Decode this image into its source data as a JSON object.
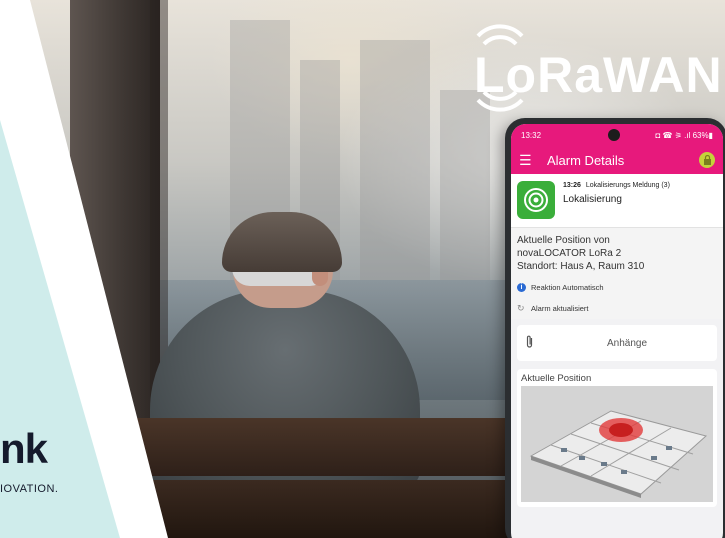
{
  "brand": {
    "word": "nk",
    "tagline": "IOVATION."
  },
  "lorawan": {
    "logo_text": "LoRaWAN",
    "icon": "wireless-signal-icon"
  },
  "phone": {
    "status_bar": {
      "time": "13:32",
      "indicators": "◘ ☎ ⚞ .ıl 63%▮"
    },
    "app_bar": {
      "title": "Alarm Details",
      "menu_icon": "hamburger-menu-icon",
      "lock_icon": "lock-icon",
      "accent_color": "#e7197c",
      "lock_color": "#c5d33a"
    },
    "alarm": {
      "time": "13:26",
      "type": "Lokalisierungs Meldung (3)",
      "title": "Lokalisierung",
      "icon": "localization-target-icon",
      "icon_color": "#3aae3a"
    },
    "details": {
      "line1": "Aktuelle Position von",
      "line2": "novaLOCATOR LoRa 2",
      "line3": "Standort: Haus A, Raum 310"
    },
    "status": {
      "reaction": "Reaktion Automatisch",
      "updated": "Alarm aktualisiert"
    },
    "attachments": {
      "label": "Anhänge",
      "icon": "paperclip-icon"
    },
    "position": {
      "label": "Aktuelle Position",
      "map": "floor-plan-3d-icon"
    }
  }
}
